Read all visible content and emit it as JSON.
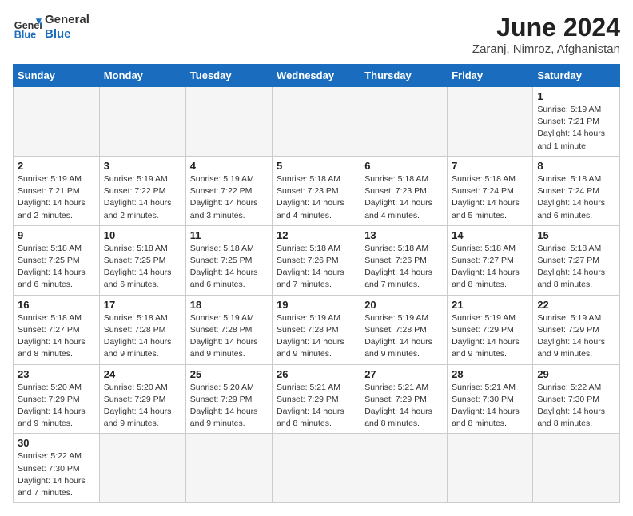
{
  "header": {
    "logo_general": "General",
    "logo_blue": "Blue",
    "month_title": "June 2024",
    "subtitle": "Zaranj, Nimroz, Afghanistan"
  },
  "days_of_week": [
    "Sunday",
    "Monday",
    "Tuesday",
    "Wednesday",
    "Thursday",
    "Friday",
    "Saturday"
  ],
  "weeks": [
    [
      {
        "day": "",
        "info": ""
      },
      {
        "day": "",
        "info": ""
      },
      {
        "day": "",
        "info": ""
      },
      {
        "day": "",
        "info": ""
      },
      {
        "day": "",
        "info": ""
      },
      {
        "day": "",
        "info": ""
      },
      {
        "day": "1",
        "info": "Sunrise: 5:19 AM\nSunset: 7:21 PM\nDaylight: 14 hours and 1 minute."
      }
    ],
    [
      {
        "day": "2",
        "info": "Sunrise: 5:19 AM\nSunset: 7:21 PM\nDaylight: 14 hours and 2 minutes."
      },
      {
        "day": "3",
        "info": "Sunrise: 5:19 AM\nSunset: 7:22 PM\nDaylight: 14 hours and 2 minutes."
      },
      {
        "day": "4",
        "info": "Sunrise: 5:19 AM\nSunset: 7:22 PM\nDaylight: 14 hours and 3 minutes."
      },
      {
        "day": "5",
        "info": "Sunrise: 5:18 AM\nSunset: 7:23 PM\nDaylight: 14 hours and 4 minutes."
      },
      {
        "day": "6",
        "info": "Sunrise: 5:18 AM\nSunset: 7:23 PM\nDaylight: 14 hours and 4 minutes."
      },
      {
        "day": "7",
        "info": "Sunrise: 5:18 AM\nSunset: 7:24 PM\nDaylight: 14 hours and 5 minutes."
      },
      {
        "day": "8",
        "info": "Sunrise: 5:18 AM\nSunset: 7:24 PM\nDaylight: 14 hours and 6 minutes."
      }
    ],
    [
      {
        "day": "9",
        "info": "Sunrise: 5:18 AM\nSunset: 7:25 PM\nDaylight: 14 hours and 6 minutes."
      },
      {
        "day": "10",
        "info": "Sunrise: 5:18 AM\nSunset: 7:25 PM\nDaylight: 14 hours and 6 minutes."
      },
      {
        "day": "11",
        "info": "Sunrise: 5:18 AM\nSunset: 7:25 PM\nDaylight: 14 hours and 6 minutes."
      },
      {
        "day": "12",
        "info": "Sunrise: 5:18 AM\nSunset: 7:26 PM\nDaylight: 14 hours and 7 minutes."
      },
      {
        "day": "13",
        "info": "Sunrise: 5:18 AM\nSunset: 7:26 PM\nDaylight: 14 hours and 7 minutes."
      },
      {
        "day": "14",
        "info": "Sunrise: 5:18 AM\nSunset: 7:27 PM\nDaylight: 14 hours and 8 minutes."
      },
      {
        "day": "15",
        "info": "Sunrise: 5:18 AM\nSunset: 7:27 PM\nDaylight: 14 hours and 8 minutes."
      }
    ],
    [
      {
        "day": "16",
        "info": "Sunrise: 5:18 AM\nSunset: 7:27 PM\nDaylight: 14 hours and 8 minutes."
      },
      {
        "day": "17",
        "info": "Sunrise: 5:18 AM\nSunset: 7:28 PM\nDaylight: 14 hours and 9 minutes."
      },
      {
        "day": "18",
        "info": "Sunrise: 5:19 AM\nSunset: 7:28 PM\nDaylight: 14 hours and 9 minutes."
      },
      {
        "day": "19",
        "info": "Sunrise: 5:19 AM\nSunset: 7:28 PM\nDaylight: 14 hours and 9 minutes."
      },
      {
        "day": "20",
        "info": "Sunrise: 5:19 AM\nSunset: 7:28 PM\nDaylight: 14 hours and 9 minutes."
      },
      {
        "day": "21",
        "info": "Sunrise: 5:19 AM\nSunset: 7:29 PM\nDaylight: 14 hours and 9 minutes."
      },
      {
        "day": "22",
        "info": "Sunrise: 5:19 AM\nSunset: 7:29 PM\nDaylight: 14 hours and 9 minutes."
      }
    ],
    [
      {
        "day": "23",
        "info": "Sunrise: 5:20 AM\nSunset: 7:29 PM\nDaylight: 14 hours and 9 minutes."
      },
      {
        "day": "24",
        "info": "Sunrise: 5:20 AM\nSunset: 7:29 PM\nDaylight: 14 hours and 9 minutes."
      },
      {
        "day": "25",
        "info": "Sunrise: 5:20 AM\nSunset: 7:29 PM\nDaylight: 14 hours and 9 minutes."
      },
      {
        "day": "26",
        "info": "Sunrise: 5:21 AM\nSunset: 7:29 PM\nDaylight: 14 hours and 8 minutes."
      },
      {
        "day": "27",
        "info": "Sunrise: 5:21 AM\nSunset: 7:29 PM\nDaylight: 14 hours and 8 minutes."
      },
      {
        "day": "28",
        "info": "Sunrise: 5:21 AM\nSunset: 7:30 PM\nDaylight: 14 hours and 8 minutes."
      },
      {
        "day": "29",
        "info": "Sunrise: 5:22 AM\nSunset: 7:30 PM\nDaylight: 14 hours and 8 minutes."
      }
    ],
    [
      {
        "day": "30",
        "info": "Sunrise: 5:22 AM\nSunset: 7:30 PM\nDaylight: 14 hours and 7 minutes."
      },
      {
        "day": "",
        "info": ""
      },
      {
        "day": "",
        "info": ""
      },
      {
        "day": "",
        "info": ""
      },
      {
        "day": "",
        "info": ""
      },
      {
        "day": "",
        "info": ""
      },
      {
        "day": "",
        "info": ""
      }
    ]
  ]
}
